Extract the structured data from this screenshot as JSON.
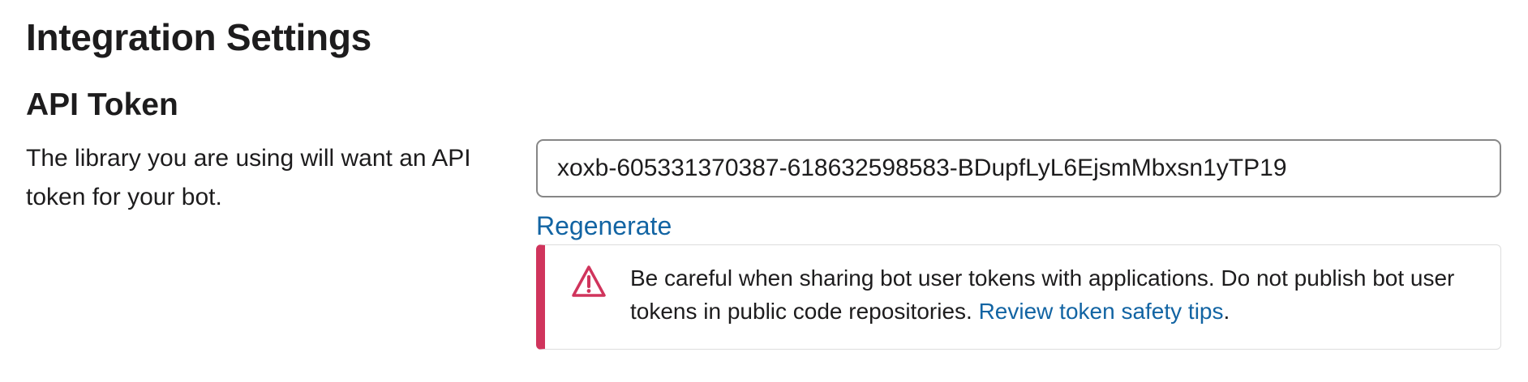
{
  "page": {
    "title": "Integration Settings"
  },
  "api_token": {
    "heading": "API Token",
    "description": "The library you are using will want an API token for your bot.",
    "token_value": "xoxb-605331370387-618632598583-BDupfLyL6EjsmMbxsn1yTP19",
    "regenerate_label": "Regenerate"
  },
  "warning": {
    "icon": "warning-triangle-icon",
    "text": "Be careful when sharing bot user tokens with applications. Do not publish bot user tokens in public code repositories. ",
    "link_label": "Review token safety tips",
    "trailing": ".",
    "accent_color": "#d0345c",
    "link_color": "#1264a3"
  }
}
